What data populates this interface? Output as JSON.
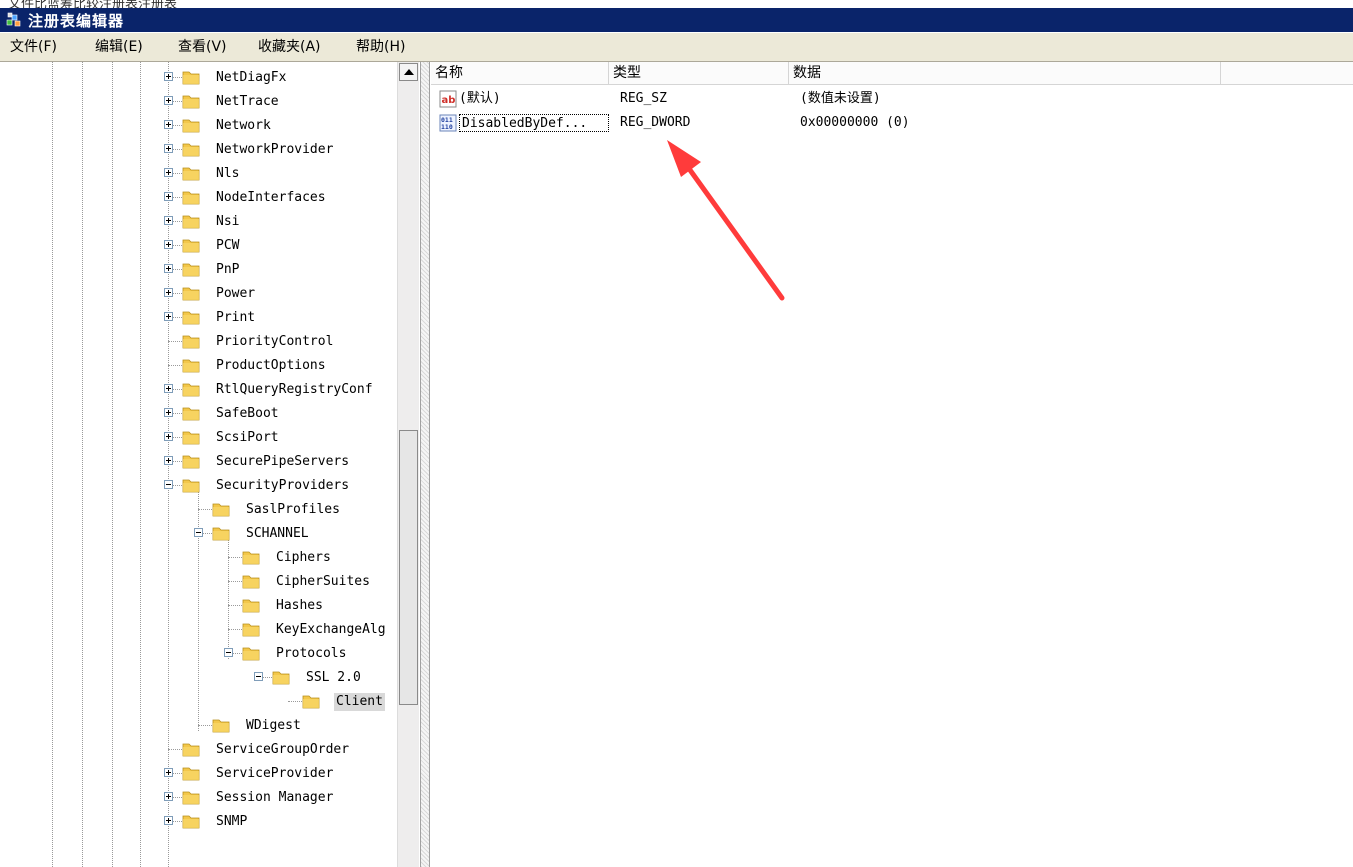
{
  "top_strip_text": "文件比蓝筹比较注册表注册表",
  "window": {
    "title": "注册表编辑器"
  },
  "menu": [
    {
      "label": "文件(F)"
    },
    {
      "label": "编辑(E)"
    },
    {
      "label": "查看(V)"
    },
    {
      "label": "收藏夹(A)"
    },
    {
      "label": "帮助(H)"
    }
  ],
  "tree": {
    "items": [
      {
        "label": "NetDiagFx",
        "level": 0,
        "expander": "plus"
      },
      {
        "label": "NetTrace",
        "level": 0,
        "expander": "plus"
      },
      {
        "label": "Network",
        "level": 0,
        "expander": "plus"
      },
      {
        "label": "NetworkProvider",
        "level": 0,
        "expander": "plus"
      },
      {
        "label": "Nls",
        "level": 0,
        "expander": "plus"
      },
      {
        "label": "NodeInterfaces",
        "level": 0,
        "expander": "plus"
      },
      {
        "label": "Nsi",
        "level": 0,
        "expander": "plus"
      },
      {
        "label": "PCW",
        "level": 0,
        "expander": "plus"
      },
      {
        "label": "PnP",
        "level": 0,
        "expander": "plus"
      },
      {
        "label": "Power",
        "level": 0,
        "expander": "plus"
      },
      {
        "label": "Print",
        "level": 0,
        "expander": "plus"
      },
      {
        "label": "PriorityControl",
        "level": 0,
        "expander": "none"
      },
      {
        "label": "ProductOptions",
        "level": 0,
        "expander": "none"
      },
      {
        "label": "RtlQueryRegistryConf",
        "level": 0,
        "expander": "plus"
      },
      {
        "label": "SafeBoot",
        "level": 0,
        "expander": "plus"
      },
      {
        "label": "ScsiPort",
        "level": 0,
        "expander": "plus"
      },
      {
        "label": "SecurePipeServers",
        "level": 0,
        "expander": "plus"
      },
      {
        "label": "SecurityProviders",
        "level": 0,
        "expander": "minus"
      },
      {
        "label": "SaslProfiles",
        "level": 1,
        "expander": "none"
      },
      {
        "label": "SCHANNEL",
        "level": 1,
        "expander": "minus"
      },
      {
        "label": "Ciphers",
        "level": 2,
        "expander": "none"
      },
      {
        "label": "CipherSuites",
        "level": 2,
        "expander": "none"
      },
      {
        "label": "Hashes",
        "level": 2,
        "expander": "none"
      },
      {
        "label": "KeyExchangeAlg",
        "level": 2,
        "expander": "none"
      },
      {
        "label": "Protocols",
        "level": 2,
        "expander": "minus"
      },
      {
        "label": "SSL 2.0",
        "level": 3,
        "expander": "minus"
      },
      {
        "label": "Client",
        "level": 4,
        "expander": "none",
        "selected": true
      },
      {
        "label": "WDigest",
        "level": 1,
        "expander": "none"
      },
      {
        "label": "ServiceGroupOrder",
        "level": 0,
        "expander": "none"
      },
      {
        "label": "ServiceProvider",
        "level": 0,
        "expander": "plus"
      },
      {
        "label": "Session Manager",
        "level": 0,
        "expander": "plus"
      },
      {
        "label": "SNMP",
        "level": 0,
        "expander": "plus"
      }
    ]
  },
  "list": {
    "headers": {
      "name": "名称",
      "type": "类型",
      "data": "数据"
    },
    "rows": [
      {
        "icon": "string-value-icon",
        "name": "(默认)",
        "type": "REG_SZ",
        "data": "(数值未设置)"
      },
      {
        "icon": "dword-value-icon",
        "name": "DisabledByDef...",
        "type": "REG_DWORD",
        "data": "0x00000000 (0)"
      }
    ]
  },
  "colors": {
    "title_bar": "#0a246a",
    "folder": "#f3c74a",
    "annotation_arrow": "#ff3b3b",
    "selection": "#d9d9d9"
  }
}
